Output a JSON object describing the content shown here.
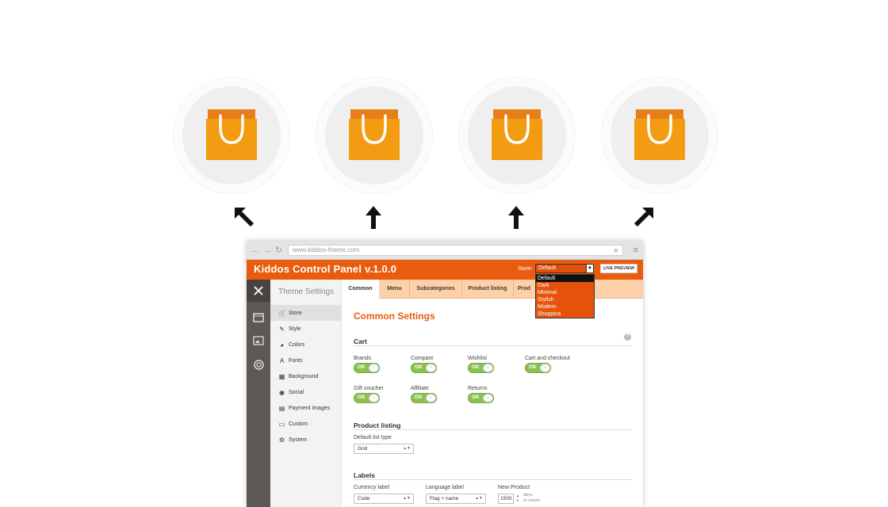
{
  "colors": {
    "accent": "#e95c0e",
    "toggle_on": "#8cc152",
    "bag_top": "#e67e1a",
    "bag_body": "#f39c12"
  },
  "bags": [
    {
      "icon": "shopping-bag-icon"
    },
    {
      "icon": "shopping-bag-icon"
    },
    {
      "icon": "shopping-bag-icon"
    },
    {
      "icon": "shopping-bag-icon"
    }
  ],
  "browser": {
    "back": "←",
    "forward": "→",
    "reload": "↻",
    "url": "www.kiddos-theme.com",
    "star": "★",
    "menu": "≡"
  },
  "panel": {
    "title": "Kiddos Control Panel v.1.0.0",
    "store_label": "Store:",
    "store_value": "Default",
    "live_preview": "LIVE PREVIEW",
    "store_options": [
      "Default",
      "Dark",
      "Minimal",
      "Stylish",
      "Modern",
      "Shoppica"
    ]
  },
  "sidebar": {
    "heading": "Theme Settings",
    "items": [
      {
        "label": "Store",
        "icon": "cart-icon",
        "glyph": "🛒"
      },
      {
        "label": "Style",
        "icon": "brush-icon",
        "glyph": "✎"
      },
      {
        "label": "Colors",
        "icon": "color-wheel-icon",
        "glyph": "◕"
      },
      {
        "label": "Fonts",
        "icon": "font-icon",
        "glyph": "A"
      },
      {
        "label": "Background",
        "icon": "background-icon",
        "glyph": "▦"
      },
      {
        "label": "Social",
        "icon": "social-icon",
        "glyph": "◉"
      },
      {
        "label": "Payment images",
        "icon": "payment-icon",
        "glyph": "▤"
      },
      {
        "label": "Custom",
        "icon": "custom-icon",
        "glyph": "▭"
      },
      {
        "label": "System",
        "icon": "gear-icon",
        "glyph": "⚙"
      }
    ]
  },
  "tabs": [
    "Common",
    "Menu",
    "Subcategories",
    "Product listing",
    "Prod"
  ],
  "content": {
    "title": "Common Settings",
    "cart_section": "Cart",
    "help": "?",
    "cart_fields": [
      {
        "label": "Brands",
        "state": "ON"
      },
      {
        "label": "Compare",
        "state": "ON"
      },
      {
        "label": "Wishlist",
        "state": "ON"
      },
      {
        "label": "Cart and checkout",
        "state": "ON"
      },
      {
        "label": "Gift voucher",
        "state": "ON"
      },
      {
        "label": "Affiliate",
        "state": "ON"
      },
      {
        "label": "Returns",
        "state": "ON"
      }
    ],
    "product_listing_section": "Product listing",
    "default_list_type_label": "Default list type",
    "default_list_type_value": "Grid",
    "labels_section": "Labels",
    "currency_label": "Currency label",
    "currency_value": "Code",
    "language_label": "Language label",
    "language_value": "Flag + name",
    "new_product_label": "New Product",
    "new_product_value": "1500",
    "new_product_unit_1": "days",
    "new_product_unit_2": "or newer"
  }
}
